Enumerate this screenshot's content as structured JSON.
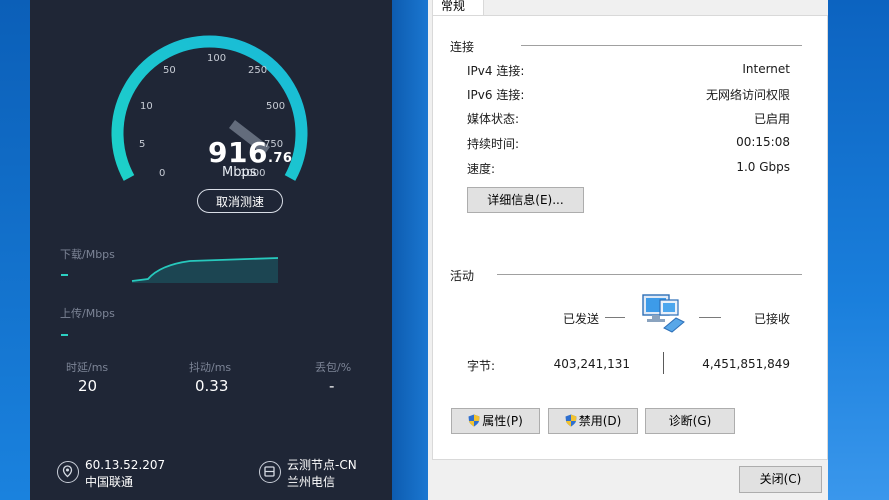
{
  "speedtest": {
    "value_int": "916",
    "value_dec": ".76",
    "unit": "Mbps",
    "scale": [
      "0",
      "5",
      "10",
      "50",
      "100",
      "250",
      "500",
      "750",
      "1000"
    ],
    "cancel_label": "取消测速",
    "download_label": "下载/Mbps",
    "download_value": "-",
    "upload_label": "上传/Mbps",
    "upload_value": "-",
    "stats": [
      {
        "label": "时延/ms",
        "value": "20"
      },
      {
        "label": "抖动/ms",
        "value": "0.33"
      },
      {
        "label": "丢包/%",
        "value": "-"
      }
    ],
    "ip": "60.13.52.207",
    "isp": "中国联通",
    "node_title": "云测节点-CN",
    "node_name": "兰州电信"
  },
  "dialog": {
    "tab_label": "常规",
    "connection_header": "连接",
    "rows": [
      {
        "label": "IPv4 连接:",
        "value": "Internet"
      },
      {
        "label": "IPv6 连接:",
        "value": "无网络访问权限"
      },
      {
        "label": "媒体状态:",
        "value": "已启用"
      },
      {
        "label": "持续时间:",
        "value": "00:15:08"
      },
      {
        "label": "速度:",
        "value": "1.0 Gbps"
      }
    ],
    "details_button": "详细信息(E)...",
    "activity_header": "活动",
    "sent_label": "已发送",
    "received_label": "已接收",
    "bytes_label": "字节:",
    "bytes_sent": "403,241,131",
    "bytes_received": "4,451,851,849",
    "properties_button": "属性(P)",
    "disable_button": "禁用(D)",
    "diagnose_button": "诊断(G)",
    "close_button": "关闭(C)"
  },
  "colors": {
    "accent": "#22c7d0",
    "panel": "#1f2636",
    "dialog_bg": "#f0f0f0"
  }
}
